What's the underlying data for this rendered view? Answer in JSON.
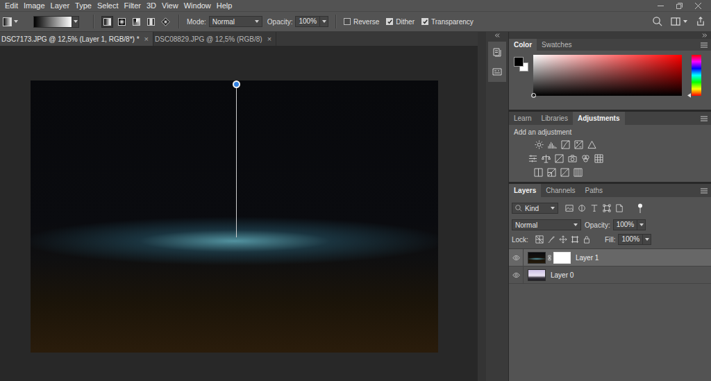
{
  "menu": [
    "Edit",
    "Image",
    "Layer",
    "Type",
    "Select",
    "Filter",
    "3D",
    "View",
    "Window",
    "Help"
  ],
  "options_bar": {
    "gradient_types": [
      {
        "kind": "linear",
        "selected": true
      },
      {
        "kind": "radial",
        "selected": false
      },
      {
        "kind": "angle",
        "selected": false
      },
      {
        "kind": "reflected",
        "selected": false
      },
      {
        "kind": "diamond",
        "selected": false
      }
    ],
    "mode_label": "Mode:",
    "mode": "Normal",
    "opacity_label": "Opacity:",
    "opacity": "100%",
    "checkboxes": [
      {
        "label": "Reverse",
        "checked": false
      },
      {
        "label": "Dither",
        "checked": true
      },
      {
        "label": "Transparency",
        "checked": true
      }
    ]
  },
  "document_tabs": [
    {
      "label": "DSC7173.JPG @ 12,5% (Layer 1, RGB/8*) *",
      "close": "×",
      "selected": true
    },
    {
      "label": "DSC08829.JPG @ 12,5% (RGB/8)",
      "close": "×",
      "selected": false
    }
  ],
  "color_panel": {
    "tabs": [
      {
        "label": "Color",
        "selected": true
      },
      {
        "label": "Swatches",
        "selected": false
      }
    ],
    "foreground": "#000000",
    "background": "#ffffff"
  },
  "adjustments_panel": {
    "tabs": [
      {
        "label": "Learn",
        "selected": false
      },
      {
        "label": "Libraries",
        "selected": false
      },
      {
        "label": "Adjustments",
        "selected": true
      }
    ],
    "hint": "Add an adjustment"
  },
  "layers_panel": {
    "tabs": [
      {
        "label": "Layers",
        "selected": true
      },
      {
        "label": "Channels",
        "selected": false
      },
      {
        "label": "Paths",
        "selected": false
      }
    ],
    "filter_kind": "Kind",
    "filter_enabled": true,
    "blend_mode": "Normal",
    "opacity_label": "Opacity:",
    "opacity": "100%",
    "lock_label": "Lock:",
    "fill_label": "Fill:",
    "fill": "100%",
    "layers": [
      {
        "name": "Layer 1",
        "visible": true,
        "selected": true,
        "has_mask": true
      },
      {
        "name": "Layer 0",
        "visible": true,
        "selected": false,
        "has_mask": false
      }
    ]
  }
}
